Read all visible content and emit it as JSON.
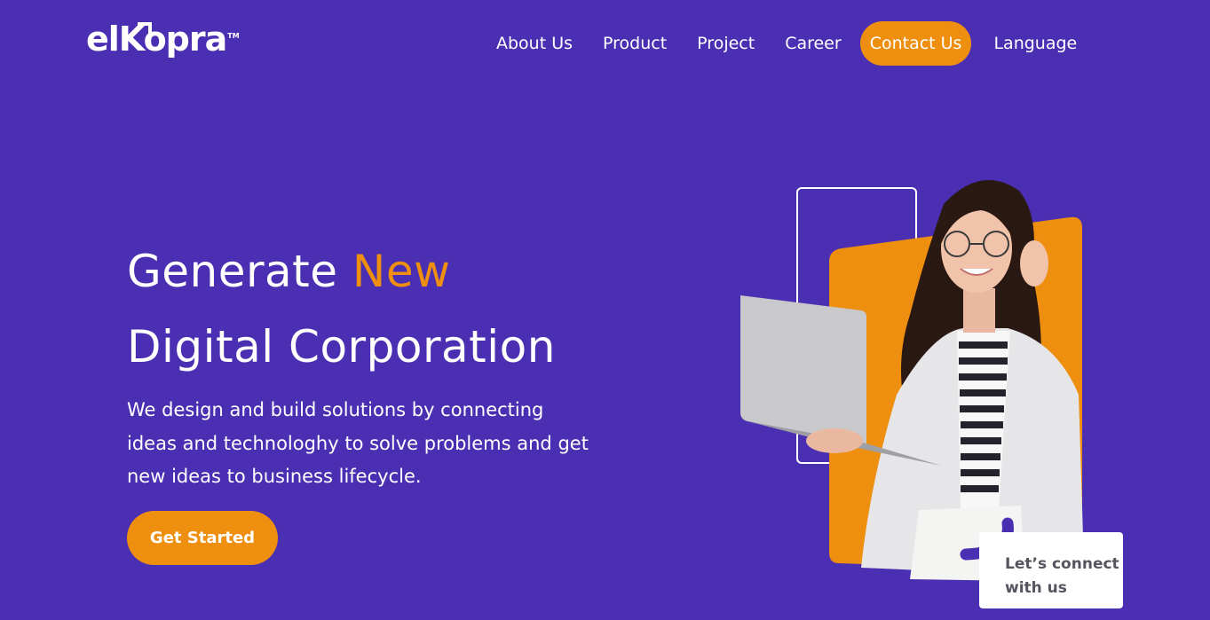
{
  "logo": {
    "text": "elKopra",
    "tm": "TM"
  },
  "nav": {
    "about": "About Us",
    "product": "Product",
    "project": "Project",
    "career": "Career",
    "contact": "Contact Us",
    "language": "Language"
  },
  "hero": {
    "title_part1": "Generate ",
    "title_accent": "New",
    "title_line2": "Digital Corporation",
    "description": "We design and build solutions by connecting ideas and technologhy to solve problems and get new ideas to business lifecycle.",
    "cta_label": "Get Started"
  },
  "connect_card": {
    "text": "Let’s connect\nwith us"
  },
  "colors": {
    "background": "#4a2fb2",
    "accent": "#ee8f0f",
    "white": "#ffffff"
  },
  "icons": {
    "illustration": "woman-with-laptop-illustration"
  }
}
